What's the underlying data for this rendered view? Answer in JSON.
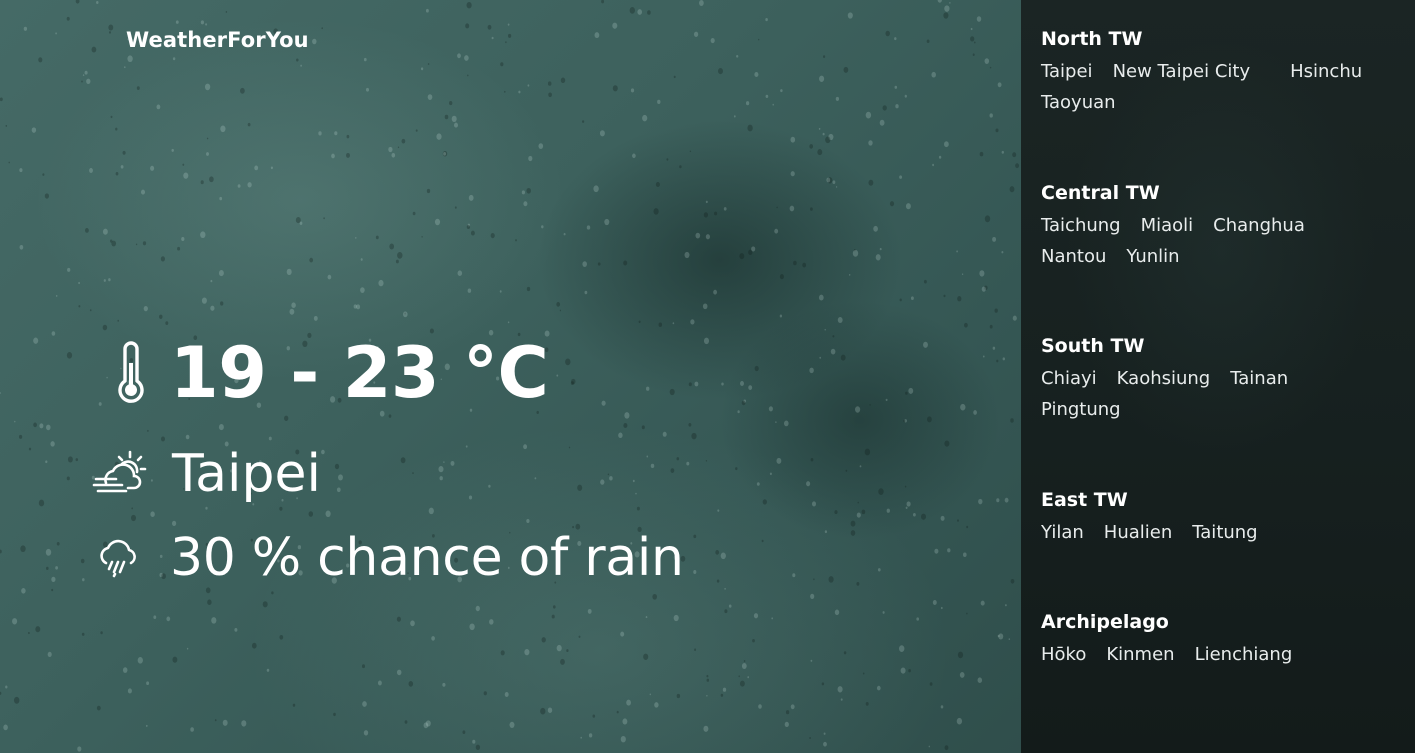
{
  "brand": "WeatherForYou",
  "current": {
    "temperature_range": "19 - 23 °C",
    "city": "Taipei",
    "rain_chance": "30 % chance of rain",
    "icons": {
      "temperature": "thermometer-icon",
      "condition": "partly-cloudy-sun-icon",
      "rain": "rain-cloud-icon"
    }
  },
  "regions": [
    {
      "title": "North TW",
      "cities": [
        "Taipei",
        "New Taipei City",
        "Hsinchu",
        "Taoyuan"
      ]
    },
    {
      "title": "Central TW",
      "cities": [
        "Taichung",
        "Miaoli",
        "Changhua",
        "Nantou",
        "Yunlin"
      ]
    },
    {
      "title": "South TW",
      "cities": [
        "Chiayi",
        "Kaohsiung",
        "Tainan",
        "Pingtung"
      ]
    },
    {
      "title": "East TW",
      "cities": [
        "Yilan",
        "Hualien",
        "Taitung"
      ]
    },
    {
      "title": "Archipelago",
      "cities": [
        "Hōko",
        "Kinmen",
        "Lienchiang"
      ]
    }
  ],
  "colors": {
    "hero_background": "#3d615d",
    "sidebar_background": "#172120",
    "text": "#ffffff"
  }
}
